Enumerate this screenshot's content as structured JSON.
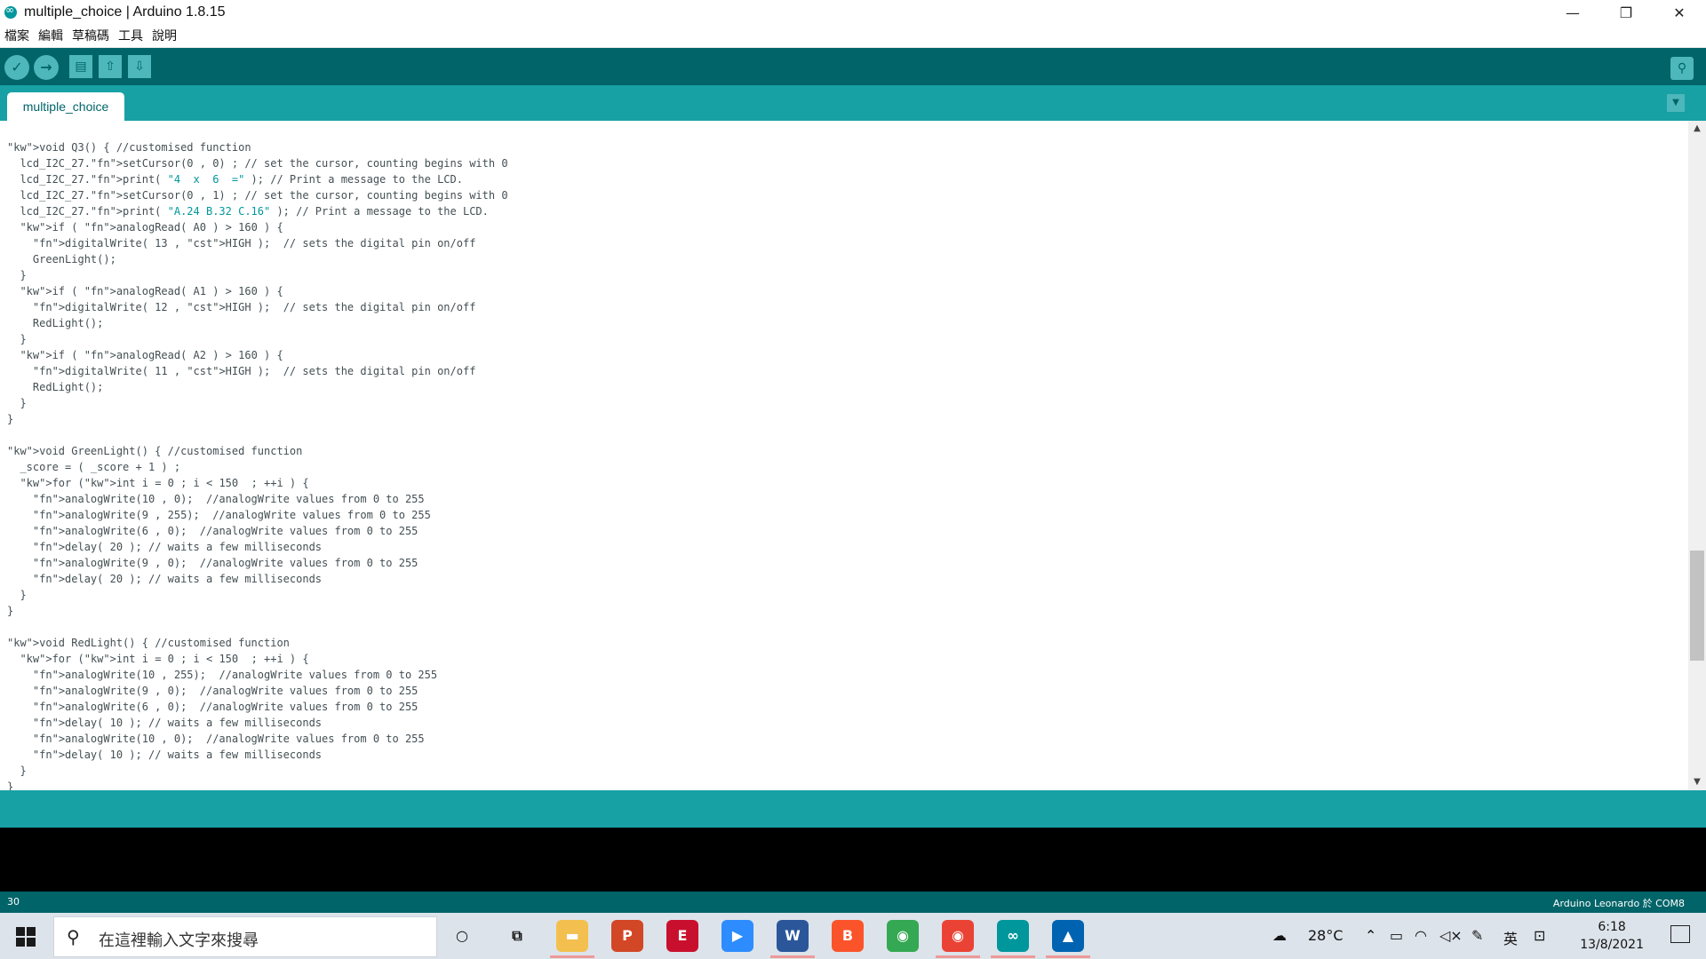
{
  "window": {
    "title": "multiple_choice | Arduino 1.8.15",
    "controls": [
      "—",
      "❐",
      "✕"
    ]
  },
  "menu": [
    "檔案",
    "編輯",
    "草稿碼",
    "工具",
    "說明"
  ],
  "toolbar": {
    "verify_icon": "✓",
    "upload_icon": "→",
    "new_icon": "▤",
    "open_icon": "⇧",
    "save_icon": "⇩",
    "serial_icon": "⚲"
  },
  "tab": {
    "label": "multiple_choice",
    "menu_icon": "▼"
  },
  "editor": {
    "lines": [
      "void Q3() { //customised function",
      "  lcd_I2C_27.setCursor(0 , 0) ; // set the cursor, counting begins with 0",
      "  lcd_I2C_27.print( \"4  x  6  =\" ); // Print a message to the LCD.",
      "  lcd_I2C_27.setCursor(0 , 1) ; // set the cursor, counting begins with 0",
      "  lcd_I2C_27.print( \"A.24 B.32 C.16\" ); // Print a message to the LCD.",
      "  if ( analogRead( A0 ) > 160 ) {",
      "    digitalWrite( 13 , HIGH );  // sets the digital pin on/off",
      "    GreenLight();",
      "  }",
      "  if ( analogRead( A1 ) > 160 ) {",
      "    digitalWrite( 12 , HIGH );  // sets the digital pin on/off",
      "    RedLight();",
      "  }",
      "  if ( analogRead( A2 ) > 160 ) {",
      "    digitalWrite( 11 , HIGH );  // sets the digital pin on/off",
      "    RedLight();",
      "  }",
      "}",
      "",
      "void GreenLight() { //customised function",
      "  _score = ( _score + 1 ) ;",
      "  for (int i = 0 ; i < 150  ; ++i ) {",
      "    analogWrite(10 , 0);  //analogWrite values from 0 to 255",
      "    analogWrite(9 , 255);  //analogWrite values from 0 to 255",
      "    analogWrite(6 , 0);  //analogWrite values from 0 to 255",
      "    delay( 20 ); // waits a few milliseconds",
      "    analogWrite(9 , 0);  //analogWrite values from 0 to 255",
      "    delay( 20 ); // waits a few milliseconds",
      "  }",
      "}",
      "",
      "void RedLight() { //customised function",
      "  for (int i = 0 ; i < 150  ; ++i ) {",
      "    analogWrite(10 , 255);  //analogWrite values from 0 to 255",
      "    analogWrite(9 , 0);  //analogWrite values from 0 to 255",
      "    analogWrite(6 , 0);  //analogWrite values from 0 to 255",
      "    delay( 10 ); // waits a few milliseconds",
      "    analogWrite(10 , 0);  //analogWrite values from 0 to 255",
      "    delay( 10 ); // waits a few milliseconds",
      "  }",
      "}"
    ]
  },
  "status": {
    "line_number": "30",
    "board": "Arduino Leonardo 於 COM8"
  },
  "taskbar": {
    "search_placeholder": "在這裡輸入文字來搜尋",
    "apps": [
      {
        "name": "cortana",
        "glyph": "○",
        "color": "transparent"
      },
      {
        "name": "task-view",
        "glyph": "⧉",
        "color": "transparent"
      },
      {
        "name": "file-explorer",
        "glyph": "▬",
        "color": "#f3c04f"
      },
      {
        "name": "powerpoint",
        "glyph": "P",
        "color": "#d24726"
      },
      {
        "name": "eph",
        "glyph": "E",
        "color": "#c8102e"
      },
      {
        "name": "zoom",
        "glyph": "▶",
        "color": "#2d8cff"
      },
      {
        "name": "word",
        "glyph": "W",
        "color": "#2b579a"
      },
      {
        "name": "brave",
        "glyph": "B",
        "color": "#fb542b"
      },
      {
        "name": "chrome",
        "glyph": "◉",
        "color": "#34a853"
      },
      {
        "name": "chrome-profile",
        "glyph": "◉",
        "color": "#ea4335"
      },
      {
        "name": "arduino",
        "glyph": "∞",
        "color": "#00979c"
      },
      {
        "name": "photos",
        "glyph": "▲",
        "color": "#0063b1"
      }
    ],
    "weather": "28°C",
    "ime": "英",
    "time": "6:18",
    "date": "13/8/2021"
  }
}
